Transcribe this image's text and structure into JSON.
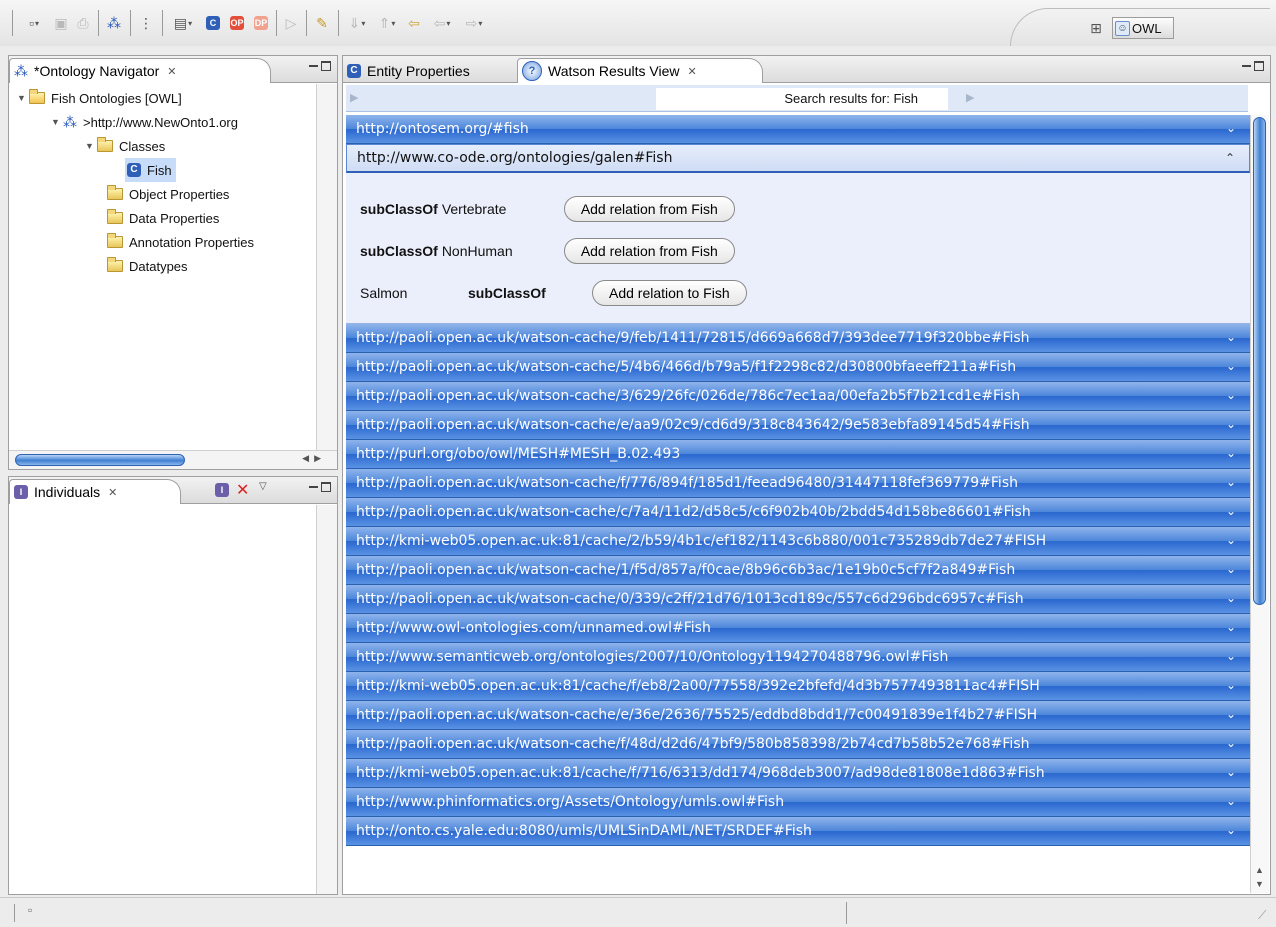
{
  "perspective": {
    "label": "OWL"
  },
  "navigator": {
    "tab_title": "*Ontology Navigator",
    "tree": {
      "root": "Fish Ontologies [OWL]",
      "ontology": ">http://www.NewOnto1.org",
      "classes": "Classes",
      "selected_class": "Fish",
      "object_properties": "Object Properties",
      "data_properties": "Data Properties",
      "annotation_properties": "Annotation Properties",
      "datatypes": "Datatypes"
    }
  },
  "individuals": {
    "tab_title": "Individuals"
  },
  "editor": {
    "tabs": [
      "Entity Properties",
      "Watson Results View"
    ],
    "search_label": "Search results for: Fish"
  },
  "results": {
    "before": [
      "http://ontosem.org/#fish"
    ],
    "expanded_url": "http://www.co-ode.org/ontologies/galen#Fish",
    "relations": [
      {
        "subject": "",
        "predicate": "subClassOf",
        "object": "Vertebrate",
        "button": "Add relation from Fish"
      },
      {
        "subject": "",
        "predicate": "subClassOf",
        "object": "NonHuman",
        "button": "Add relation from Fish"
      },
      {
        "subject": "Salmon",
        "predicate": "subClassOf",
        "object": "",
        "button": "Add relation to Fish"
      }
    ],
    "after": [
      "http://paoli.open.ac.uk/watson-cache/9/feb/1411/72815/d669a668d7/393dee7719f320bbe#Fish",
      "http://paoli.open.ac.uk/watson-cache/5/4b6/466d/b79a5/f1f2298c82/d30800bfaeeff211a#Fish",
      "http://paoli.open.ac.uk/watson-cache/3/629/26fc/026de/786c7ec1aa/00efa2b5f7b21cd1e#Fish",
      "http://paoli.open.ac.uk/watson-cache/e/aa9/02c9/cd6d9/318c843642/9e583ebfa89145d54#Fish",
      "http://purl.org/obo/owl/MESH#MESH_B.02.493",
      "http://paoli.open.ac.uk/watson-cache/f/776/894f/185d1/feead96480/31447118fef369779#Fish",
      "http://paoli.open.ac.uk/watson-cache/c/7a4/11d2/d58c5/c6f902b40b/2bdd54d158be86601#Fish",
      "http://kmi-web05.open.ac.uk:81/cache/2/b59/4b1c/ef182/1143c6b880/001c735289db7de27#FISH",
      "http://paoli.open.ac.uk/watson-cache/1/f5d/857a/f0cae/8b96c6b3ac/1e19b0c5cf7f2a849#Fish",
      "http://paoli.open.ac.uk/watson-cache/0/339/c2ff/21d76/1013cd189c/557c6d296bdc6957c#Fish",
      "http://www.owl-ontologies.com/unnamed.owl#Fish",
      "http://www.semanticweb.org/ontologies/2007/10/Ontology1194270488796.owl#Fish",
      "http://kmi-web05.open.ac.uk:81/cache/f/eb8/2a00/77558/392e2bfefd/4d3b7577493811ac4#FISH",
      "http://paoli.open.ac.uk/watson-cache/e/36e/2636/75525/eddbd8bdd1/7c00491839e1f4b27#FISH",
      "http://paoli.open.ac.uk/watson-cache/f/48d/d2d6/47bf9/580b858398/2b74cd7b58b52e768#Fish",
      "http://kmi-web05.open.ac.uk:81/cache/f/716/6313/dd174/968deb3007/ad98de81808e1d863#Fish",
      "http://www.phinformatics.org/Assets/Ontology/umls.owl#Fish",
      "http://onto.cs.yale.edu:8080/umls/UMLSinDAML/NET/SRDEF#Fish"
    ]
  }
}
